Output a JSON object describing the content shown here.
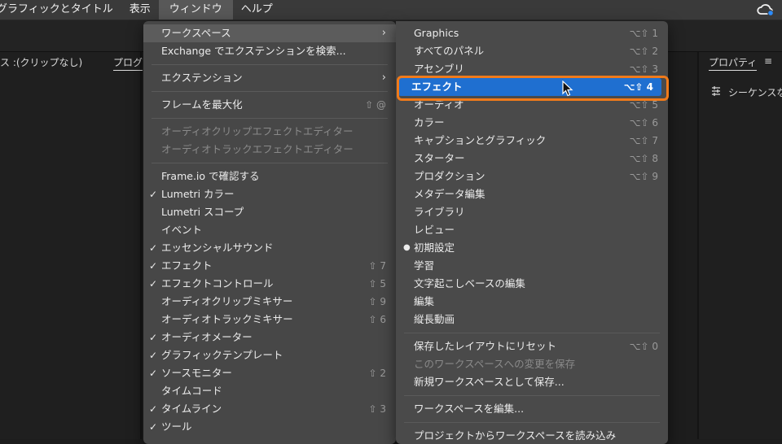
{
  "menubar": {
    "items": [
      "グラフィックとタイトル",
      "表示",
      "ウィンドウ",
      "ヘルプ"
    ],
    "active": "ウィンドウ"
  },
  "panels": {
    "left_label": "ス :(クリップなし)",
    "left_tab": "プログ",
    "right_title": "プロパティ",
    "right_menu": "≡",
    "right_item": "シーケンスな"
  },
  "window_menu": [
    {
      "label": "ワークスペース",
      "submenu": true,
      "highlight": true
    },
    {
      "label": "Exchange でエクステンションを検索..."
    },
    {
      "sep": true
    },
    {
      "label": "エクステンション",
      "submenu": true
    },
    {
      "sep": true
    },
    {
      "label": "フレームを最大化",
      "shortcut": "⇧ @"
    },
    {
      "sep": true
    },
    {
      "label": "オーディオクリップエフェクトエディター",
      "disabled": true
    },
    {
      "label": "オーディオトラックエフェクトエディター",
      "disabled": true
    },
    {
      "sep": true
    },
    {
      "label": "Frame.io で確認する"
    },
    {
      "label": "Lumetri カラー",
      "checked": true
    },
    {
      "label": "Lumetri スコープ"
    },
    {
      "label": "イベント"
    },
    {
      "label": "エッセンシャルサウンド",
      "checked": true
    },
    {
      "label": "エフェクト",
      "checked": true,
      "shortcut": "⇧ 7"
    },
    {
      "label": "エフェクトコントロール",
      "checked": true,
      "shortcut": "⇧ 5"
    },
    {
      "label": "オーディオクリップミキサー",
      "shortcut": "⇧ 9"
    },
    {
      "label": "オーディオトラックミキサー",
      "shortcut": "⇧ 6"
    },
    {
      "label": "オーディオメーター",
      "checked": true
    },
    {
      "label": "グラフィックテンプレート",
      "checked": true
    },
    {
      "label": "ソースモニター",
      "checked": true,
      "shortcut": "⇧ 2"
    },
    {
      "label": "タイムコード"
    },
    {
      "label": "タイムライン",
      "checked": true,
      "shortcut": "⇧ 3"
    },
    {
      "label": "ツール",
      "checked": true
    }
  ],
  "workspace_menu": [
    {
      "label": "Graphics",
      "shortcut": "⌥⇧ 1"
    },
    {
      "label": "すべてのパネル",
      "shortcut": "⌥⇧ 2"
    },
    {
      "label": "アセンブリ",
      "shortcut": "⌥⇧ 3"
    },
    {
      "label": "エフェクト",
      "shortcut": "⌥⇧ 4",
      "selected": true
    },
    {
      "label": "オーディオ",
      "shortcut": "⌥⇧ 5"
    },
    {
      "label": "カラー",
      "shortcut": "⌥⇧ 6"
    },
    {
      "label": "キャプションとグラフィック",
      "shortcut": "⌥⇧ 7"
    },
    {
      "label": "スターター",
      "shortcut": "⌥⇧ 8"
    },
    {
      "label": "プロダクション",
      "shortcut": "⌥⇧ 9"
    },
    {
      "label": "メタデータ編集"
    },
    {
      "label": "ライブラリ"
    },
    {
      "label": "レビュー"
    },
    {
      "label": "初期設定",
      "bullet": true
    },
    {
      "label": "学習"
    },
    {
      "label": "文字起こしベースの編集"
    },
    {
      "label": "編集"
    },
    {
      "label": "縦長動画"
    },
    {
      "sep": true
    },
    {
      "label": "保存したレイアウトにリセット",
      "shortcut": "⌥⇧ 0"
    },
    {
      "label": "このワークスペースへの変更を保存",
      "disabled": true
    },
    {
      "label": "新規ワークスペースとして保存..."
    },
    {
      "sep": true
    },
    {
      "label": "ワークスペースを編集..."
    },
    {
      "sep": true
    },
    {
      "label": "プロジェクトからワークスペースを読み込み"
    }
  ],
  "icons": {
    "creative_cloud": "creative-cloud-icon",
    "cursor": "mouse-pointer-icon",
    "checkmark": "✓",
    "bullet": "●",
    "submenu_arrow": "›"
  },
  "colors": {
    "selection": "#1f6fd0",
    "annotation_outline": "#f07a1a"
  }
}
